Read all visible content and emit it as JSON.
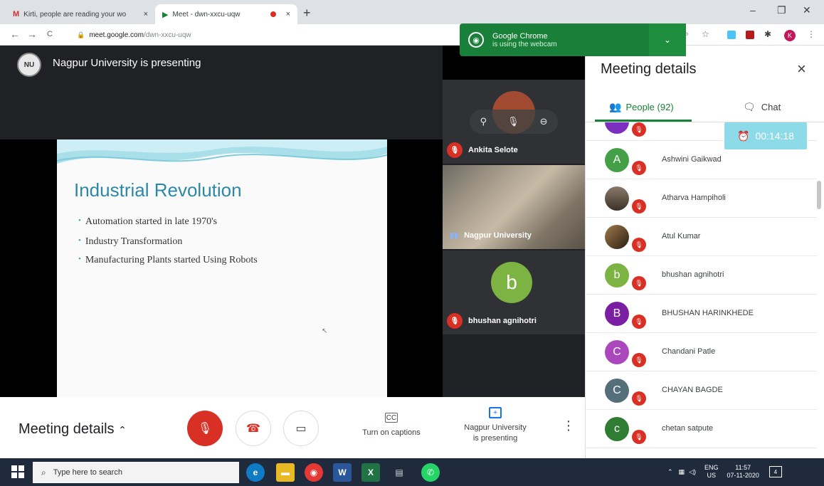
{
  "browser": {
    "tabs": [
      {
        "favicon": "M",
        "title": "Kirti, people are reading your wo",
        "close": "×"
      },
      {
        "favicon": "▶",
        "title": "Meet - dwn-xxcu-uqw",
        "close": "×"
      }
    ],
    "new_tab": "+",
    "window_controls": {
      "minimize": "–",
      "restore": "❐",
      "close": "✕"
    },
    "nav": {
      "back": "←",
      "forward": "→",
      "reload": "C"
    },
    "url_domain": "meet.google.com",
    "url_path": "/dwn-xxcu-uqw",
    "profile_initial": "K",
    "webcam_popup": {
      "line1": "Google Chrome",
      "line2": "is using the webcam"
    }
  },
  "presentation": {
    "presenter_label": "Nagpur University is presenting",
    "slide": {
      "heading": "Industrial Revolution",
      "bullets": [
        "Automation started in late 1970's",
        "Industry Transformation",
        "Manufacturing Plants started Using Robots"
      ]
    }
  },
  "tiles": [
    {
      "name": "Ankita Selote"
    },
    {
      "name": "Nagpur University"
    },
    {
      "name": "bhushan agnihotri",
      "initial": "b"
    }
  ],
  "bottom_bar": {
    "meeting_details": "Meeting details",
    "captions_label": "Turn on captions",
    "captions_icon": "CC",
    "presenting_line1": "Nagpur University",
    "presenting_line2": "is presenting"
  },
  "panel": {
    "title": "Meeting details",
    "tab_people": "People (92)",
    "tab_chat": "Chat",
    "timer": "00:14:18",
    "participants": [
      {
        "initial": "",
        "name": "",
        "color": "#7b2fbe"
      },
      {
        "initial": "A",
        "name": "Ashwini Gaikwad",
        "color": "#43a047"
      },
      {
        "initial": "",
        "name": "Atharva Hampiholi",
        "color": "#6d5a4a"
      },
      {
        "initial": "",
        "name": "Atul Kumar",
        "color": "#3a2a1c"
      },
      {
        "initial": "b",
        "name": "bhushan agnihotri",
        "color": "#7cb342"
      },
      {
        "initial": "B",
        "name": "BHUSHAN HARINKHEDE",
        "color": "#7b1fa2"
      },
      {
        "initial": "C",
        "name": "Chandani Patle",
        "color": "#ab47bc"
      },
      {
        "initial": "C",
        "name": "CHAYAN BAGDE",
        "color": "#546e7a"
      },
      {
        "initial": "c",
        "name": "chetan satpute",
        "color": "#2e7d32"
      }
    ]
  },
  "taskbar": {
    "search_placeholder": "Type here to search",
    "lang_top": "ENG",
    "lang_bottom": "US",
    "time": "11:57",
    "date": "07-11-2020",
    "notification_count": "4"
  },
  "colors": {
    "accent_green": "#188038",
    "mic_off_red": "#d93025",
    "meet_bg": "#202124"
  }
}
